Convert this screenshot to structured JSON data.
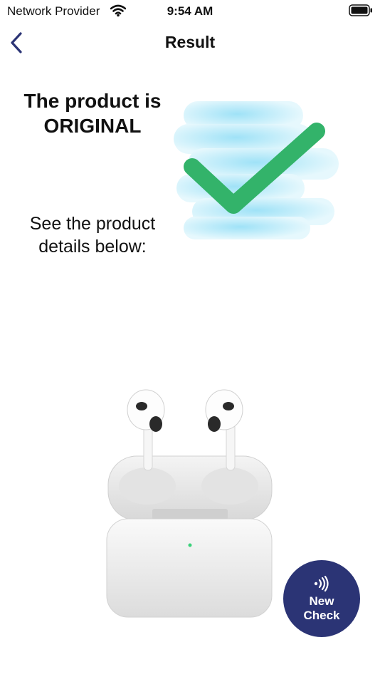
{
  "status_bar": {
    "carrier": "Network Provider",
    "time": "9:54 AM",
    "wifi_icon": "wifi-icon",
    "battery_icon": "battery-icon"
  },
  "nav": {
    "title": "Result",
    "back_icon": "chevron-left-icon"
  },
  "result": {
    "heading": "The product is ORIGINAL",
    "subtext": "See the product details below:",
    "status_icon": "checkmark-icon",
    "check_color": "#33b36a"
  },
  "product": {
    "image_icon": "earbuds-case-image"
  },
  "new_check_button": {
    "label": "New\nCheck",
    "icon": "nfc-icon",
    "background": "#2b3475"
  }
}
